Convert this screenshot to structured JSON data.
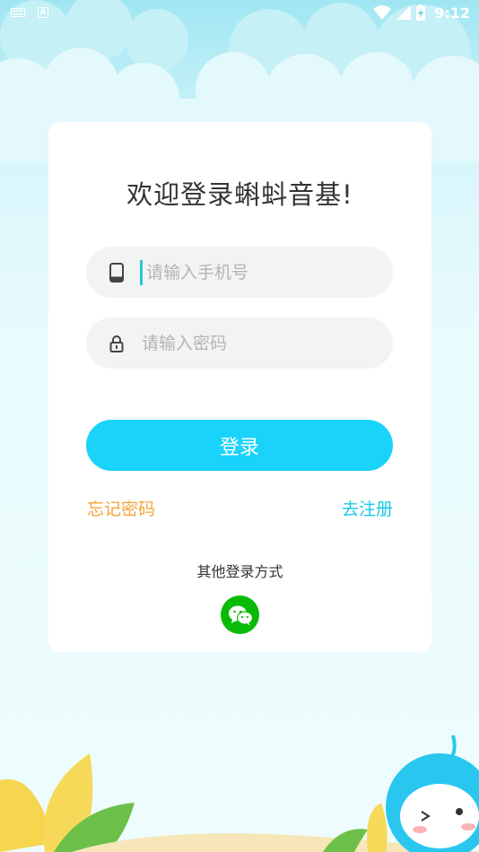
{
  "status_bar": {
    "time": "9:12",
    "keyboard_icon": "keyboard-icon",
    "a_icon": "A",
    "wifi_icon": "wifi-icon",
    "signal_icon": "signal-icon",
    "battery_icon": "battery-charging-icon"
  },
  "login": {
    "title": "欢迎登录蝌蚪音基!",
    "phone_placeholder": "请输入手机号",
    "password_placeholder": "请输入密码",
    "phone_icon": "phone-icon",
    "lock_icon": "lock-icon",
    "login_button": "登录",
    "forgot_password": "忘记密码",
    "register": "去注册",
    "other_methods": "其他登录方式",
    "wechat_icon": "wechat-icon"
  },
  "colors": {
    "accent": "#1ad3fb",
    "forgot": "#f6a43a",
    "register": "#1ac7e8",
    "wechat": "#09bb07"
  }
}
